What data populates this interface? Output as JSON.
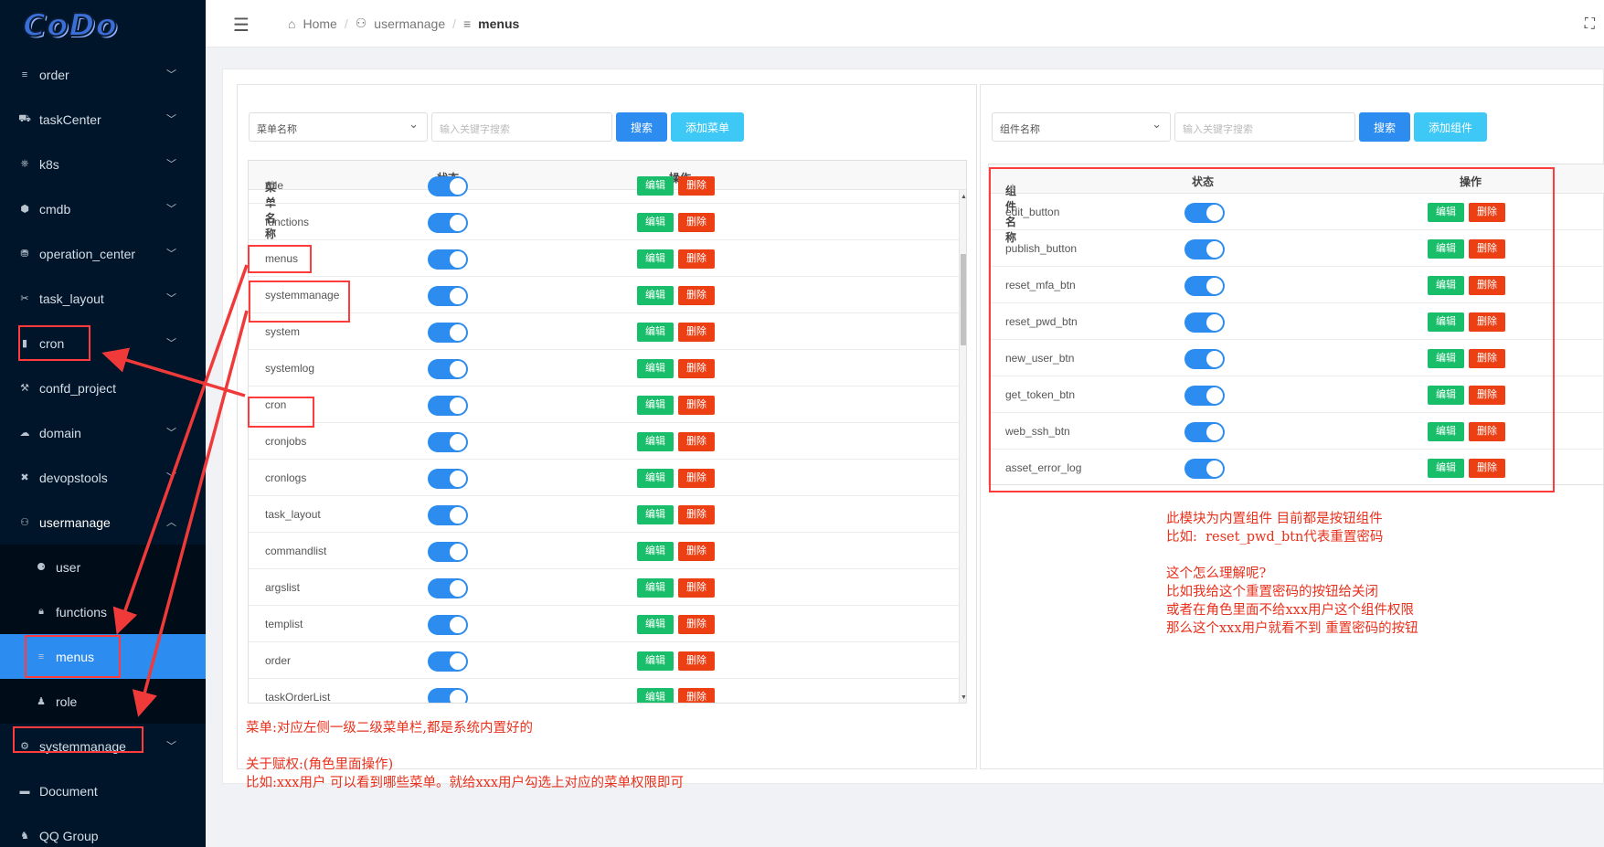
{
  "logo": {
    "text": "CoDo"
  },
  "sidebar": {
    "items": [
      {
        "label": "order",
        "icon": "list-icon",
        "chevron": "down"
      },
      {
        "label": "taskCenter",
        "icon": "task-icon",
        "chevron": "down"
      },
      {
        "label": "k8s",
        "icon": "k8s-icon",
        "chevron": "down"
      },
      {
        "label": "cmdb",
        "icon": "cube-icon",
        "chevron": "down"
      },
      {
        "label": "operation_center",
        "icon": "operation-icon",
        "chevron": "down"
      },
      {
        "label": "task_layout",
        "icon": "layout-icon",
        "chevron": "down"
      },
      {
        "label": "cron",
        "icon": "cron-icon",
        "chevron": "down"
      },
      {
        "label": "confd_project",
        "icon": "wrench-icon",
        "chevron": ""
      },
      {
        "label": "domain",
        "icon": "cloud-icon",
        "chevron": "down"
      },
      {
        "label": "devopstools",
        "icon": "tools-icon",
        "chevron": "down"
      },
      {
        "label": "usermanage",
        "icon": "users-icon",
        "chevron": "up"
      },
      {
        "label": "user",
        "icon": "user-group-icon",
        "chevron": "",
        "sub": true
      },
      {
        "label": "functions",
        "icon": "lock-icon",
        "chevron": "",
        "sub": true
      },
      {
        "label": "menus",
        "icon": "menu-icon",
        "chevron": "",
        "sub": true,
        "active": true
      },
      {
        "label": "role",
        "icon": "person-icon",
        "chevron": "",
        "sub": true
      },
      {
        "label": "systemmanage",
        "icon": "gear-icon",
        "chevron": "down"
      },
      {
        "label": "Document",
        "icon": "book-icon",
        "chevron": ""
      },
      {
        "label": "QQ Group",
        "icon": "qq-icon",
        "chevron": ""
      }
    ]
  },
  "breadcrumb": {
    "home": "Home",
    "parent": "usermanage",
    "current": "menus"
  },
  "left_panel": {
    "select": "菜单名称",
    "search_placeholder": "输入关键字搜索",
    "search_btn": "搜索",
    "add_btn": "添加菜单",
    "columns": [
      "菜单名称",
      "状态",
      "操作"
    ],
    "rows": [
      "role",
      "functions",
      "menus",
      "systemmanage",
      "system",
      "systemlog",
      "cron",
      "cronjobs",
      "cronlogs",
      "task_layout",
      "commandlist",
      "argslist",
      "templist",
      "order",
      "taskOrderList"
    ]
  },
  "right_panel": {
    "select": "组件名称",
    "search_placeholder": "输入关键字搜索",
    "search_btn": "搜索",
    "add_btn": "添加组件",
    "columns": [
      "组件名称",
      "状态",
      "操作"
    ],
    "rows": [
      "edit_button",
      "publish_button",
      "reset_mfa_btn",
      "reset_pwd_btn",
      "new_user_btn",
      "get_token_btn",
      "web_ssh_btn",
      "asset_error_log"
    ]
  },
  "actions": {
    "edit": "编辑",
    "delete": "删除"
  },
  "notes": {
    "right": "此模块为内置组件 目前都是按钮组件\n比如:  reset_pwd_btn代表重置密码\n\n这个怎么理解呢?\n比如我给这个重置密码的按钮给关闭\n或者在角色里面不给xxx用户这个组件权限\n那么这个xxx用户就看不到 重置密码的按钮",
    "left": "菜单:对应左侧一级二级菜单栏,都是系统内置好的\n\n关于赋权:(角色里面操作)\n比如:xxx用户 可以看到哪些菜单。就给xxx用户勾选上对应的菜单权限即可"
  },
  "colors": {
    "sidebar": "#001529",
    "active": "#2d8cf0",
    "annotation": "#ff3b3b",
    "edit": "#19be6b",
    "delete": "#ed3f14"
  }
}
